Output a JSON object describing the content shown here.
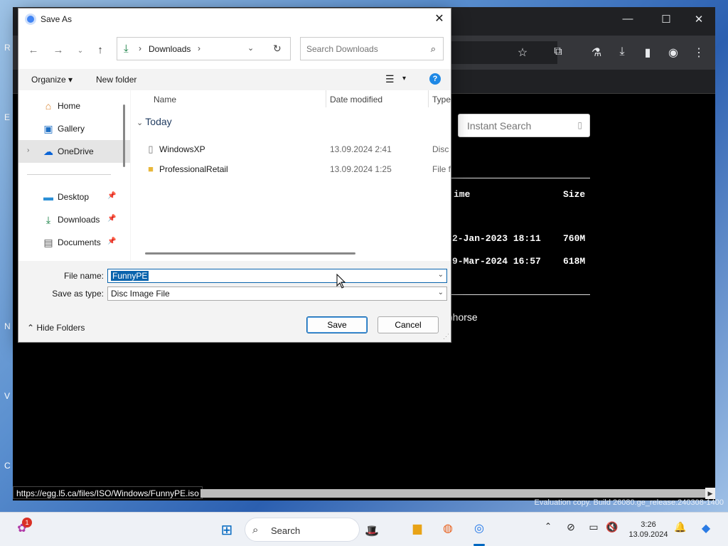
{
  "desktop": {
    "fragments": [
      "R",
      "E",
      "N",
      "V",
      "C"
    ],
    "eval_watermark": "Evaluation copy. Build 26080.ge_release.240308-1400"
  },
  "browser": {
    "instant_search": {
      "placeholder": "Instant Search",
      "icon": "search-icon"
    },
    "listing_headers": {
      "time": "ime",
      "size": "Size"
    },
    "listing_rows": [
      {
        "time": "2-Jan-2023 18:11",
        "size": "760M"
      },
      {
        "time": "9-Mar-2024 16:57",
        "size": "618M"
      }
    ],
    "footer_text": ")horse",
    "status_url": "https://egg.l5.ca/files/ISO/Windows/FunnyPE.iso"
  },
  "dialog": {
    "title": "Save As",
    "close_glyph": "✕",
    "address": {
      "crumb": "Downloads",
      "icon": "download-icon"
    },
    "search": {
      "placeholder": "Search Downloads"
    },
    "toolbar": {
      "organize": "Organize ▾",
      "new_folder": "New folder",
      "view_glyph": "☰",
      "dropdown_glyph": "▾",
      "help_glyph": "?"
    },
    "nav": [
      {
        "label": "Home",
        "icon": "home-icon"
      },
      {
        "label": "Gallery",
        "icon": "gallery-icon"
      },
      {
        "label": "OneDrive",
        "icon": "cloud-icon",
        "selected": true
      },
      {
        "label": "Desktop",
        "icon": "desktop-icon",
        "pinned": true
      },
      {
        "label": "Downloads",
        "icon": "download-icon",
        "pinned": true
      },
      {
        "label": "Documents",
        "icon": "document-icon",
        "pinned": true
      }
    ],
    "columns": {
      "name": "Name",
      "date": "Date modified",
      "type": "Type"
    },
    "group": "Today",
    "files": [
      {
        "name": "WindowsXP",
        "date": "13.09.2024 2:41",
        "type": "Disc Image File",
        "icon": "disc-image-icon"
      },
      {
        "name": "ProfessionalRetail",
        "date": "13.09.2024 1:25",
        "type": "File folder",
        "icon": "folder-icon"
      }
    ],
    "file_name": {
      "label": "File name:",
      "value": "FunnyPE"
    },
    "save_type": {
      "label": "Save as type:",
      "value": "Disc Image File"
    },
    "hide_folders": "Hide Folders",
    "save_button": "Save",
    "cancel_button": "Cancel"
  },
  "taskbar": {
    "search_label": "Search",
    "chat_badge": "1",
    "clock_time": "3:26",
    "clock_date": "13.09.2024"
  }
}
